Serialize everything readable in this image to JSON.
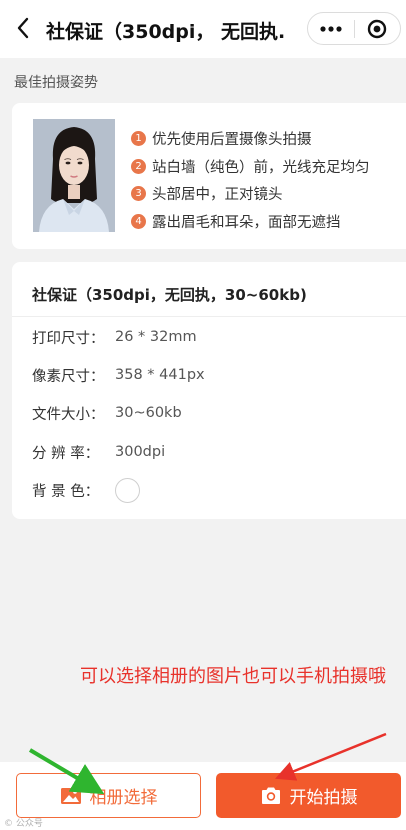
{
  "navbar": {
    "title": "社保证（350dpi， 无回执...",
    "back_icon": "chevron-left-icon",
    "more_icon": "more-dots-icon",
    "close_icon": "target-circle-icon"
  },
  "pose_section": {
    "title": "最佳拍摄姿势",
    "tips": [
      {
        "num": "1",
        "text": "优先使用后置摄像头拍摄"
      },
      {
        "num": "2",
        "text": "站白墙（纯色）前，光线充足均匀"
      },
      {
        "num": "3",
        "text": "头部居中，正对镜头"
      },
      {
        "num": "4",
        "text": "露出眉毛和耳朵，面部无遮挡"
      }
    ]
  },
  "spec": {
    "title": "社保证（350dpi，无回执，30~60kb)",
    "rows": [
      {
        "label": "打印尺寸：",
        "value": "26 * 32mm"
      },
      {
        "label": "像素尺寸：",
        "value": "358 * 441px"
      },
      {
        "label": "文件大小：",
        "value": "30~60kb"
      },
      {
        "label": "分 辨 率：",
        "value": "300dpi"
      },
      {
        "label": "背 景 色：",
        "value": ""
      }
    ],
    "background_color": "#ffffff"
  },
  "annotation": "可以选择相册的图片也可以手机拍摄哦",
  "buttons": {
    "album_label": "相册选择",
    "album_icon": "image-icon",
    "camera_label": "开始拍摄",
    "camera_icon": "camera-icon"
  },
  "watermark": "© 公众号",
  "colors": {
    "accent": "#f25a2c",
    "tip_badge": "#e8764a",
    "annotation": "#e8322b",
    "arrow_green": "#2fb52f",
    "arrow_red": "#e8322b"
  }
}
